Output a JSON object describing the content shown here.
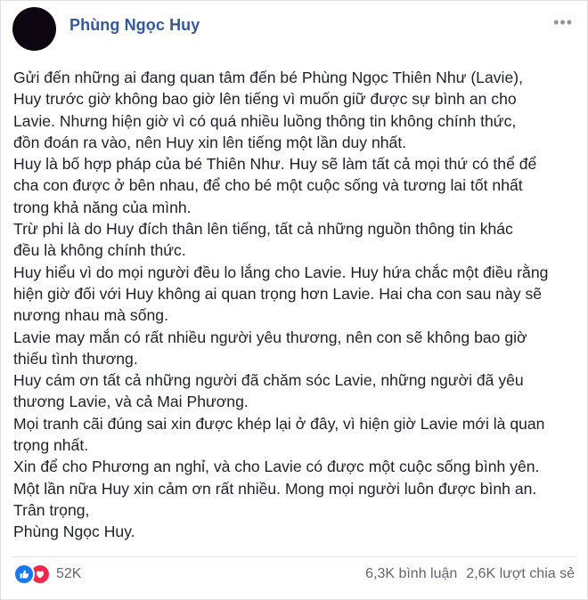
{
  "post": {
    "author": "Phùng Ngọc Huy",
    "lines": [
      "Gửi đến những ai đang quan tâm đến bé Phùng Ngọc Thiên Như (Lavie),",
      "Huy trước giờ không bao giờ lên tiếng vì muốn giữ được sự bình an cho",
      "Lavie. Nhưng hiện giờ vì có quá nhiều luồng thông tin không chính thức,",
      "đồn đoán ra vào, nên Huy xin lên tiếng một lần duy nhất.",
      "Huy là bố hợp pháp của bé Thiên Như. Huy sẽ làm tất cả mọi thứ có thể để",
      "cha con được ở bên nhau, để cho bé một cuộc sống và tương lai tốt nhất",
      "trong khả năng của mình.",
      "Trừ phi là do Huy đích thân lên tiếng, tất cả những nguồn thông tin khác",
      "đều là không chính thức.",
      "Huy hiểu vì do mọi người đều lo lắng cho Lavie. Huy hứa chắc một điều rằng",
      "hiện giờ đối với Huy không ai quan trọng hơn Lavie. Hai cha con sau này sẽ",
      "nương nhau mà sống.",
      "Lavie may mắn có rất nhiều người yêu thương, nên con sẽ không bao giờ",
      "thiếu tình thương.",
      "Huy cám ơn tất cả những người đã chăm sóc Lavie, những người đã yêu",
      "thương Lavie, và cả Mai Phương.",
      "Mọi tranh cãi đúng sai xin được khép lại ở đây, vì hiện giờ Lavie mới là quan",
      "trọng nhất.",
      "Xin để cho Phương an nghỉ, và cho Lavie có được một cuộc sống bình yên.",
      "Một lần nữa Huy xin cảm ơn rất nhiều. Mong mọi người luôn được bình an.",
      "Trân trọng,",
      "Phùng Ngọc Huy."
    ]
  },
  "footer": {
    "reaction_count": "52K",
    "comments": "6,3K bình luận",
    "shares": "2,6K lượt chia sẻ"
  },
  "icons": {
    "more": "more-options-icon",
    "like": "like-icon",
    "love": "love-icon"
  },
  "colors": {
    "author_link": "#365899",
    "like_blue": "#1877f2",
    "love_red": "#f0284a"
  }
}
